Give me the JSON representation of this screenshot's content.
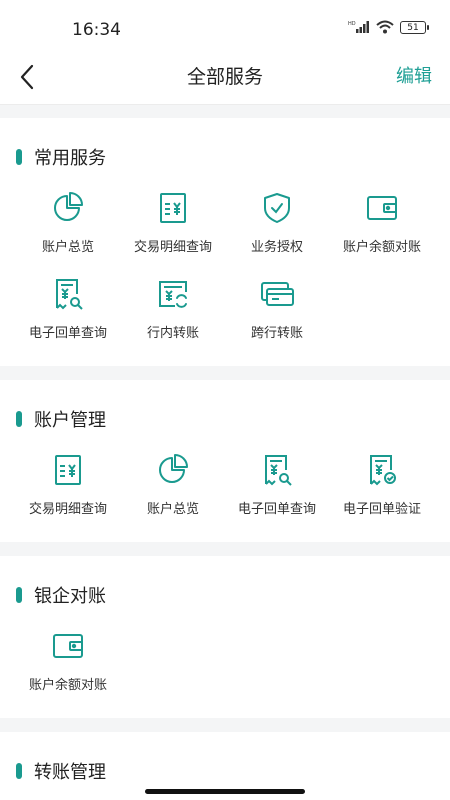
{
  "status": {
    "time": "16:34",
    "battery": "51",
    "network": "HD"
  },
  "nav": {
    "title": "全部服务",
    "edit_label": "编辑"
  },
  "sections": [
    {
      "title": "常用服务",
      "items": [
        {
          "label": "账户总览",
          "icon": "pie-chart-icon"
        },
        {
          "label": "交易明细查询",
          "icon": "yuan-doc-icon"
        },
        {
          "label": "业务授权",
          "icon": "shield-check-icon"
        },
        {
          "label": "账户余额对账",
          "icon": "wallet-icon"
        },
        {
          "label": "电子回单查询",
          "icon": "receipt-search-icon"
        },
        {
          "label": "行内转账",
          "icon": "transfer-icon"
        },
        {
          "label": "跨行转账",
          "icon": "card-icon"
        }
      ]
    },
    {
      "title": "账户管理",
      "items": [
        {
          "label": "交易明细查询",
          "icon": "yuan-doc-icon"
        },
        {
          "label": "账户总览",
          "icon": "pie-chart-icon"
        },
        {
          "label": "电子回单查询",
          "icon": "receipt-search-icon"
        },
        {
          "label": "电子回单验证",
          "icon": "receipt-verify-icon"
        }
      ]
    },
    {
      "title": "银企对账",
      "items": [
        {
          "label": "账户余额对账",
          "icon": "wallet-icon"
        }
      ]
    },
    {
      "title": "转账管理",
      "items": []
    }
  ],
  "colors": {
    "accent": "#1a9a8f",
    "text": "#222222",
    "background": "#f4f5f6"
  }
}
